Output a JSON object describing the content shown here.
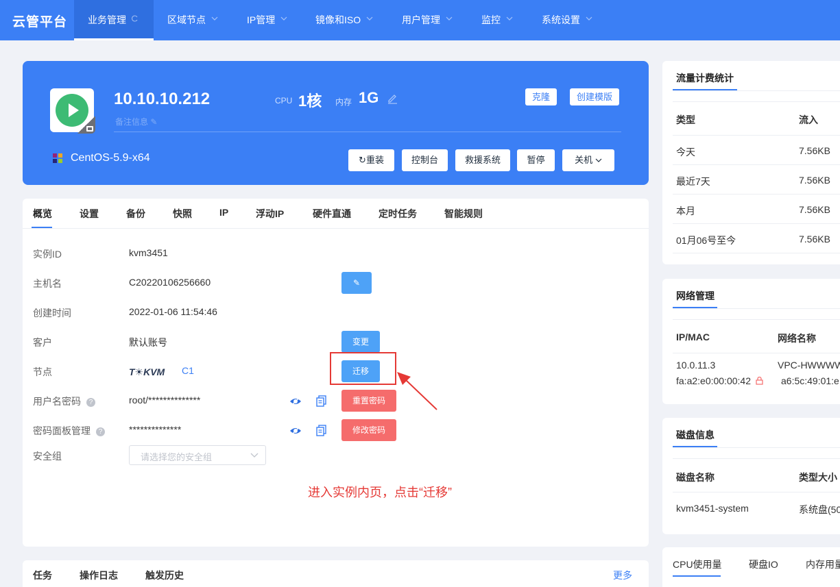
{
  "brand": "云管平台",
  "nav": {
    "items": [
      {
        "label": "业务管理",
        "active": true
      },
      {
        "label": "区域节点"
      },
      {
        "label": "IP管理"
      },
      {
        "label": "镜像和ISO"
      },
      {
        "label": "用户管理"
      },
      {
        "label": "监控"
      },
      {
        "label": "系统设置"
      }
    ]
  },
  "instance": {
    "ip": "10.10.10.212",
    "remark": "备注信息",
    "cpu_label": "CPU",
    "cpu_value": "1核",
    "mem_label": "内存",
    "mem_value": "1G",
    "clone_label": "克隆",
    "template_label": "创建模版",
    "os": "CentOS-5.9-x64",
    "actions": {
      "reinstall": "重装",
      "console": "控制台",
      "rescue": "救援系统",
      "pause": "暂停",
      "shutdown": "关机"
    }
  },
  "tabs": [
    "概览",
    "设置",
    "备份",
    "快照",
    "IP",
    "浮动IP",
    "硬件直通",
    "定时任务",
    "智能规则"
  ],
  "fields": {
    "instance_id_label": "实例ID",
    "instance_id": "kvm3451",
    "hostname_label": "主机名",
    "hostname": "C20220106256660",
    "created_label": "创建时间",
    "created": "2022-01-06 11:54:46",
    "customer_label": "客户",
    "customer": "默认账号",
    "change_label": "变更",
    "node_label": "节点",
    "node_logo": "T☀KVM",
    "node_name": "C1",
    "migrate_label": "迁移",
    "user_pass_label": "用户名密码",
    "user_pass": "root/**************",
    "reset_pass_label": "重置密码",
    "panel_pass_label": "密码面板管理",
    "panel_pass": "**************",
    "modify_pass_label": "修改密码",
    "security_group_label": "安全组",
    "security_group_placeholder": "请选择您的安全组",
    "help_glyph": "?"
  },
  "annotation": "进入实例内页，点击“迁移”",
  "bottom_tabs": [
    "任务",
    "操作日志",
    "触发历史"
  ],
  "more_label": "更多",
  "traffic": {
    "title": "流量计费统计",
    "headers": [
      "类型",
      "流入"
    ],
    "rows": [
      [
        "今天",
        "7.56KB"
      ],
      [
        "最近7天",
        "7.56KB"
      ],
      [
        "本月",
        "7.56KB"
      ],
      [
        "01月06号至今",
        "7.56KB"
      ]
    ]
  },
  "network": {
    "title": "网络管理",
    "headers": [
      "IP/MAC",
      "网络名称"
    ],
    "ip": "10.0.11.3",
    "mac": "fa:a2:e0:00:00:42",
    "net_name": "VPC-HWWWW",
    "net_mac": "a6:5c:49:01:e"
  },
  "disk": {
    "title": "磁盘信息",
    "headers": [
      "磁盘名称",
      "类型大小"
    ],
    "name": "kvm3451-system",
    "type": "系统盘(50"
  },
  "monitor": {
    "tabs": [
      "CPU使用量",
      "硬盘IO",
      "内存用量"
    ]
  },
  "colors": {
    "primary": "#3b7ff5",
    "danger": "#f56c6c",
    "running": "#3dbb74",
    "annotation": "#e53935"
  }
}
